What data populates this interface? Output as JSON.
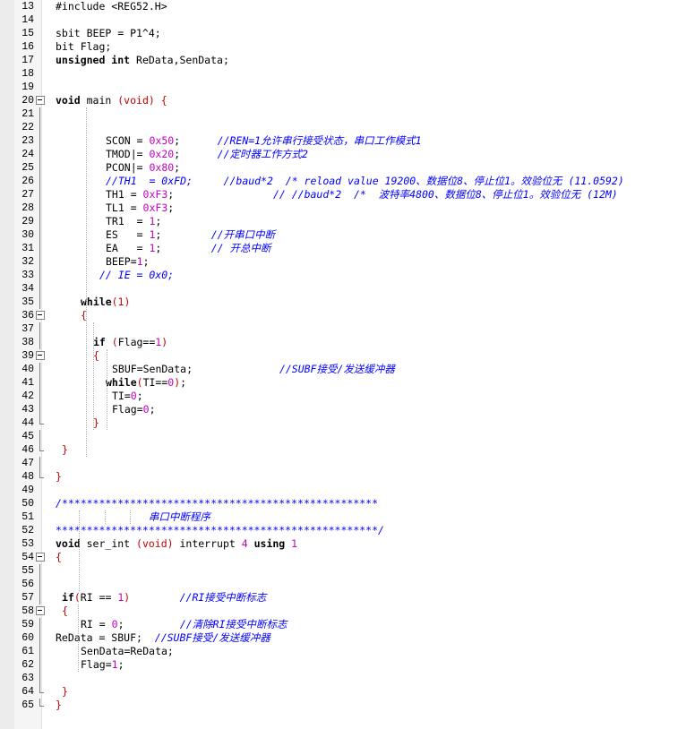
{
  "editor": {
    "lines": [
      {
        "n": "13",
        "fold": "",
        "indent": 0,
        "tokens": [
          {
            "c": "pre",
            "v": "#include <REG52.H>"
          }
        ]
      },
      {
        "n": "14",
        "fold": "",
        "indent": 0,
        "tokens": []
      },
      {
        "n": "15",
        "fold": "",
        "indent": 0,
        "tokens": [
          {
            "c": "id",
            "v": "sbit BEEP = P1^4;"
          }
        ]
      },
      {
        "n": "16",
        "fold": "",
        "indent": 0,
        "tokens": [
          {
            "c": "id",
            "v": "bit Flag;"
          }
        ]
      },
      {
        "n": "17",
        "fold": "",
        "indent": 0,
        "tokens": [
          {
            "c": "kw",
            "v": "unsigned int"
          },
          {
            "c": "id",
            "v": " ReData,SenData;"
          }
        ]
      },
      {
        "n": "18",
        "fold": "",
        "indent": 0,
        "tokens": []
      },
      {
        "n": "19",
        "fold": "",
        "indent": 0,
        "tokens": []
      },
      {
        "n": "20",
        "fold": "box",
        "indent": 0,
        "tokens": [
          {
            "c": "kw",
            "v": "void"
          },
          {
            "c": "id",
            "v": " main "
          },
          {
            "c": "br",
            "v": "(void)"
          },
          {
            "c": "id",
            "v": " "
          },
          {
            "c": "br",
            "v": "{"
          }
        ]
      },
      {
        "n": "21",
        "fold": "vline",
        "indent": 0,
        "tokens": []
      },
      {
        "n": "22",
        "fold": "vline",
        "indent": 0,
        "tokens": []
      },
      {
        "n": "23",
        "fold": "vline",
        "indent": 56,
        "tokens": [
          {
            "c": "id",
            "v": "SCON = "
          },
          {
            "c": "num",
            "v": "0x50"
          },
          {
            "c": "id",
            "v": ";      "
          },
          {
            "c": "cm",
            "v": "//REN=1允许串行接受状态，串口工作模式1"
          }
        ]
      },
      {
        "n": "24",
        "fold": "vline",
        "indent": 56,
        "tokens": [
          {
            "c": "id",
            "v": "TMOD|= "
          },
          {
            "c": "num",
            "v": "0x20"
          },
          {
            "c": "id",
            "v": ";      "
          },
          {
            "c": "cm",
            "v": "//定时器工作方式2"
          }
        ]
      },
      {
        "n": "25",
        "fold": "vline",
        "indent": 56,
        "tokens": [
          {
            "c": "id",
            "v": "PCON|= "
          },
          {
            "c": "num",
            "v": "0x80"
          },
          {
            "c": "id",
            "v": ";"
          }
        ]
      },
      {
        "n": "26",
        "fold": "vline",
        "indent": 56,
        "tokens": [
          {
            "c": "cm",
            "v": "//TH1  = 0xFD;     //baud*2  /* reload value 19200、数据位8、停止位1。效验位无 (11.0592)"
          }
        ]
      },
      {
        "n": "27",
        "fold": "vline",
        "indent": 56,
        "tokens": [
          {
            "c": "id",
            "v": "TH1 = "
          },
          {
            "c": "num",
            "v": "0xF3"
          },
          {
            "c": "id",
            "v": ";                "
          },
          {
            "c": "cm",
            "v": "// //baud*2  /*  波特率4800、数据位8、停止位1。效验位无 (12M)"
          }
        ]
      },
      {
        "n": "28",
        "fold": "vline",
        "indent": 56,
        "tokens": [
          {
            "c": "id",
            "v": "TL1 = "
          },
          {
            "c": "num",
            "v": "0xF3"
          },
          {
            "c": "id",
            "v": ";"
          }
        ]
      },
      {
        "n": "29",
        "fold": "vline",
        "indent": 56,
        "tokens": [
          {
            "c": "id",
            "v": "TR1  = "
          },
          {
            "c": "num",
            "v": "1"
          },
          {
            "c": "id",
            "v": ";"
          }
        ]
      },
      {
        "n": "30",
        "fold": "vline",
        "indent": 56,
        "tokens": [
          {
            "c": "id",
            "v": "ES   = "
          },
          {
            "c": "num",
            "v": "1"
          },
          {
            "c": "id",
            "v": ";        "
          },
          {
            "c": "cm",
            "v": "//开串口中断"
          }
        ]
      },
      {
        "n": "31",
        "fold": "vline",
        "indent": 56,
        "tokens": [
          {
            "c": "id",
            "v": "EA   = "
          },
          {
            "c": "num",
            "v": "1"
          },
          {
            "c": "id",
            "v": ";        "
          },
          {
            "c": "cm",
            "v": "// 开总中断"
          }
        ]
      },
      {
        "n": "32",
        "fold": "vline",
        "indent": 56,
        "tokens": [
          {
            "c": "id",
            "v": "BEEP="
          },
          {
            "c": "num",
            "v": "1"
          },
          {
            "c": "id",
            "v": ";"
          }
        ]
      },
      {
        "n": "33",
        "fold": "vline",
        "indent": 49,
        "tokens": [
          {
            "c": "cm",
            "v": "// IE = 0x0;"
          }
        ]
      },
      {
        "n": "34",
        "fold": "vline",
        "indent": 0,
        "tokens": []
      },
      {
        "n": "35",
        "fold": "vline",
        "indent": 28,
        "tokens": [
          {
            "c": "kw",
            "v": "while"
          },
          {
            "c": "br",
            "v": "(1)"
          }
        ]
      },
      {
        "n": "36",
        "fold": "box",
        "indent": 28,
        "tokens": [
          {
            "c": "br",
            "v": "{"
          }
        ]
      },
      {
        "n": "37",
        "fold": "vline",
        "indent": 0,
        "tokens": []
      },
      {
        "n": "38",
        "fold": "vline",
        "indent": 42,
        "tokens": [
          {
            "c": "kw",
            "v": "if"
          },
          {
            "c": "id",
            "v": " "
          },
          {
            "c": "br",
            "v": "("
          },
          {
            "c": "id",
            "v": "Flag=="
          },
          {
            "c": "num",
            "v": "1"
          },
          {
            "c": "br",
            "v": ")"
          }
        ]
      },
      {
        "n": "39",
        "fold": "box",
        "indent": 42,
        "tokens": [
          {
            "c": "br",
            "v": "{"
          }
        ]
      },
      {
        "n": "40",
        "fold": "vline",
        "indent": 63,
        "tokens": [
          {
            "c": "id",
            "v": "SBUF=SenData;              "
          },
          {
            "c": "cm",
            "v": "//SUBF接受/发送缓冲器"
          }
        ]
      },
      {
        "n": "41",
        "fold": "vline",
        "indent": 56,
        "tokens": [
          {
            "c": "kw",
            "v": "while"
          },
          {
            "c": "br",
            "v": "("
          },
          {
            "c": "id",
            "v": "TI=="
          },
          {
            "c": "num",
            "v": "0"
          },
          {
            "c": "br",
            "v": ")"
          },
          {
            "c": "id",
            "v": ";"
          }
        ]
      },
      {
        "n": "42",
        "fold": "vline",
        "indent": 63,
        "tokens": [
          {
            "c": "id",
            "v": "TI="
          },
          {
            "c": "num",
            "v": "0"
          },
          {
            "c": "id",
            "v": ";"
          }
        ]
      },
      {
        "n": "43",
        "fold": "vline",
        "indent": 63,
        "tokens": [
          {
            "c": "id",
            "v": "Flag="
          },
          {
            "c": "num",
            "v": "0"
          },
          {
            "c": "id",
            "v": ";"
          }
        ]
      },
      {
        "n": "44",
        "fold": "end",
        "indent": 42,
        "tokens": [
          {
            "c": "br",
            "v": "}"
          }
        ]
      },
      {
        "n": "45",
        "fold": "vline",
        "indent": 0,
        "tokens": []
      },
      {
        "n": "46",
        "fold": "end",
        "indent": 7,
        "tokens": [
          {
            "c": "br",
            "v": "}"
          }
        ]
      },
      {
        "n": "47",
        "fold": "vline",
        "indent": 0,
        "tokens": []
      },
      {
        "n": "48",
        "fold": "end",
        "indent": 0,
        "tokens": [
          {
            "c": "br",
            "v": "}"
          }
        ]
      },
      {
        "n": "49",
        "fold": "",
        "indent": 0,
        "tokens": []
      },
      {
        "n": "50",
        "fold": "",
        "indent": 0,
        "tokens": [
          {
            "c": "cm",
            "v": "/***************************************************"
          }
        ]
      },
      {
        "n": "51",
        "fold": "",
        "indent": 0,
        "tokens": [
          {
            "c": "cm",
            "v": "               串口中断程序"
          }
        ]
      },
      {
        "n": "52",
        "fold": "",
        "indent": 0,
        "tokens": [
          {
            "c": "cm",
            "v": "****************************************************/"
          }
        ]
      },
      {
        "n": "53",
        "fold": "",
        "indent": 0,
        "tokens": [
          {
            "c": "kw",
            "v": "void"
          },
          {
            "c": "id",
            "v": " ser_int "
          },
          {
            "c": "br",
            "v": "(void)"
          },
          {
            "c": "id",
            "v": " interrupt "
          },
          {
            "c": "num",
            "v": "4"
          },
          {
            "c": "id",
            "v": " "
          },
          {
            "c": "kw",
            "v": "using"
          },
          {
            "c": "id",
            "v": " "
          },
          {
            "c": "num",
            "v": "1"
          }
        ]
      },
      {
        "n": "54",
        "fold": "box",
        "indent": 0,
        "tokens": [
          {
            "c": "br",
            "v": "{"
          }
        ]
      },
      {
        "n": "55",
        "fold": "vline",
        "indent": 0,
        "tokens": []
      },
      {
        "n": "56",
        "fold": "vline",
        "indent": 0,
        "tokens": []
      },
      {
        "n": "57",
        "fold": "vline",
        "indent": 7,
        "tokens": [
          {
            "c": "kw",
            "v": "if"
          },
          {
            "c": "br",
            "v": "("
          },
          {
            "c": "id",
            "v": "RI == "
          },
          {
            "c": "num",
            "v": "1"
          },
          {
            "c": "br",
            "v": ")"
          },
          {
            "c": "id",
            "v": "        "
          },
          {
            "c": "cm",
            "v": "//RI接受中断标志"
          }
        ]
      },
      {
        "n": "58",
        "fold": "box",
        "indent": 7,
        "tokens": [
          {
            "c": "br",
            "v": "{"
          }
        ]
      },
      {
        "n": "59",
        "fold": "vline",
        "indent": 28,
        "tokens": [
          {
            "c": "id",
            "v": "RI = "
          },
          {
            "c": "num",
            "v": "0"
          },
          {
            "c": "id",
            "v": ";         "
          },
          {
            "c": "cm",
            "v": "//清除RI接受中断标志"
          }
        ]
      },
      {
        "n": "60",
        "fold": "vline",
        "indent": 0,
        "tokens": [
          {
            "c": "id",
            "v": "ReData = SBUF;  "
          },
          {
            "c": "cm",
            "v": "//SUBF接受/发送缓冲器"
          }
        ]
      },
      {
        "n": "61",
        "fold": "vline",
        "indent": 28,
        "tokens": [
          {
            "c": "id",
            "v": "SenData=ReData;"
          }
        ]
      },
      {
        "n": "62",
        "fold": "vline",
        "indent": 28,
        "tokens": [
          {
            "c": "id",
            "v": "Flag="
          },
          {
            "c": "num",
            "v": "1"
          },
          {
            "c": "id",
            "v": ";"
          }
        ]
      },
      {
        "n": "63",
        "fold": "vline",
        "indent": 0,
        "tokens": []
      },
      {
        "n": "64",
        "fold": "end",
        "indent": 7,
        "tokens": [
          {
            "c": "br",
            "v": "}"
          }
        ]
      },
      {
        "n": "65",
        "fold": "end",
        "indent": 0,
        "tokens": [
          {
            "c": "br",
            "v": "}"
          }
        ]
      }
    ]
  },
  "colors": {
    "comment": "#0000ff",
    "number": "#c000c0",
    "bracket": "#c00000",
    "keyword": "#000000",
    "text": "#000000",
    "gutter": "#f5f5f5"
  }
}
